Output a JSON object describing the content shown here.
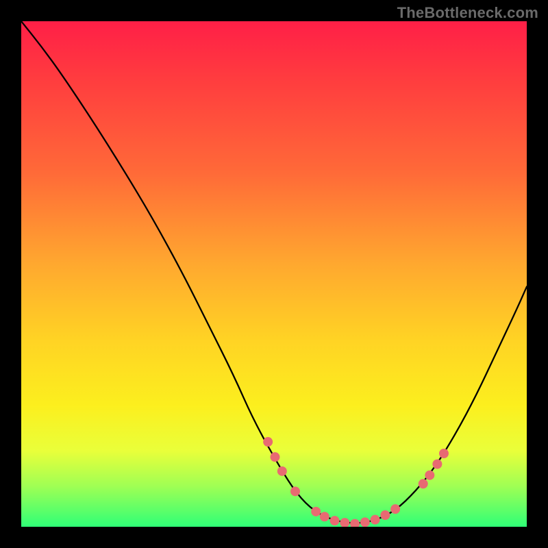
{
  "watermark": "TheBottleneck.com",
  "chart_data": {
    "type": "line",
    "title": "",
    "xlabel": "",
    "ylabel": "",
    "xlim": [
      0,
      100
    ],
    "ylim": [
      0,
      100
    ],
    "note": "No numeric axes or tick labels are visible in the image; curve and marker coordinates are expressed in percent of the plot area (0,0 = bottom-left, 100,100 = top-right) estimated from the gradient bands.",
    "series": [
      {
        "name": "curve",
        "kind": "line",
        "points_pct": [
          [
            0.0,
            100.0
          ],
          [
            4.0,
            95.0
          ],
          [
            8.0,
            89.5
          ],
          [
            14.0,
            80.5
          ],
          [
            20.0,
            71.0
          ],
          [
            26.0,
            61.0
          ],
          [
            32.0,
            50.0
          ],
          [
            37.0,
            40.0
          ],
          [
            42.0,
            30.0
          ],
          [
            46.0,
            21.0
          ],
          [
            51.0,
            12.0
          ],
          [
            54.5,
            6.5
          ],
          [
            58.0,
            3.0
          ],
          [
            62.0,
            1.2
          ],
          [
            66.0,
            0.6
          ],
          [
            70.0,
            1.2
          ],
          [
            74.0,
            3.2
          ],
          [
            78.0,
            7.0
          ],
          [
            82.0,
            12.0
          ],
          [
            86.0,
            18.5
          ],
          [
            90.0,
            26.0
          ],
          [
            94.0,
            34.5
          ],
          [
            98.0,
            43.0
          ],
          [
            100.0,
            47.5
          ]
        ]
      },
      {
        "name": "markers",
        "kind": "scatter",
        "color": "#e86a72",
        "points_pct": [
          [
            48.8,
            16.8
          ],
          [
            50.2,
            13.8
          ],
          [
            51.6,
            11.0
          ],
          [
            54.2,
            7.0
          ],
          [
            58.3,
            3.0
          ],
          [
            60.0,
            2.0
          ],
          [
            62.0,
            1.2
          ],
          [
            64.0,
            0.8
          ],
          [
            66.0,
            0.6
          ],
          [
            68.0,
            0.9
          ],
          [
            70.0,
            1.4
          ],
          [
            72.0,
            2.3
          ],
          [
            74.0,
            3.5
          ],
          [
            79.5,
            8.5
          ],
          [
            80.8,
            10.2
          ],
          [
            82.3,
            12.4
          ],
          [
            83.6,
            14.5
          ]
        ]
      }
    ]
  }
}
